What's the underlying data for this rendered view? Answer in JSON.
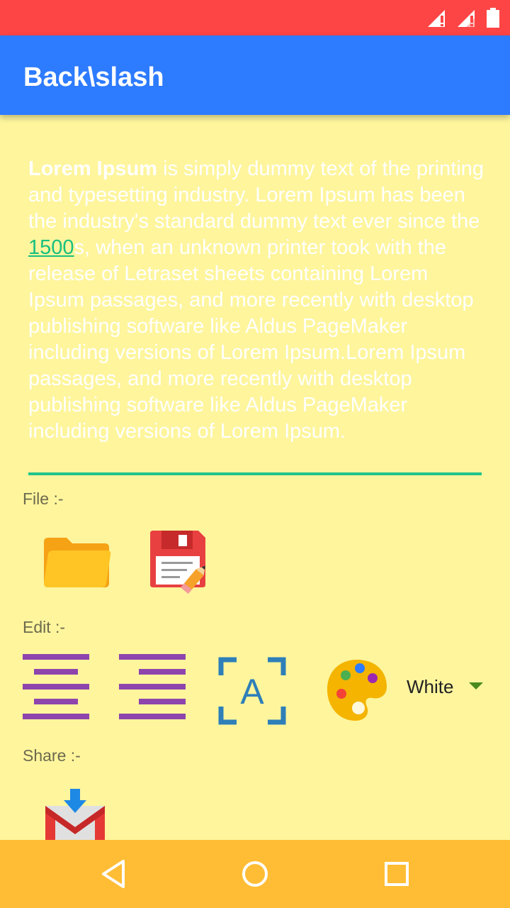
{
  "status_bar": {
    "color": "#fe4545",
    "icons": [
      "signal-icon",
      "signal-icon",
      "battery-icon"
    ]
  },
  "app_bar": {
    "title": "Back\\slash",
    "color": "#2d7bff"
  },
  "editor": {
    "bold_lead": "Lorem Ipsum",
    "text_before_link": " is simply dummy text of the printing and typesetting industry. Lorem Ipsum has been the industry's standard dummy text ever since the ",
    "link_text": "1500",
    "text_after_link": "s, when an unknown printer took with the release of Letraset sheets containing Lorem Ipsum passages, and more recently with desktop publishing software like Aldus PageMaker including versions of Lorem Ipsum.Lorem Ipsum passages, and more recently with desktop publishing software like Aldus PageMaker including versions of Lorem Ipsum."
  },
  "sections": {
    "file_label": "File :-",
    "edit_label": "Edit :-",
    "share_label": "Share :-"
  },
  "file_actions": [
    "folder-icon",
    "save-icon"
  ],
  "edit_actions": [
    "align-center-icon",
    "align-right-icon",
    "font-size-icon",
    "palette-icon"
  ],
  "color_select": {
    "selected": "White"
  },
  "share_actions": [
    "gmail-icon"
  ],
  "nav_bar": {
    "color": "#ffbd35",
    "buttons": [
      "back-icon",
      "home-icon",
      "recents-icon"
    ]
  }
}
